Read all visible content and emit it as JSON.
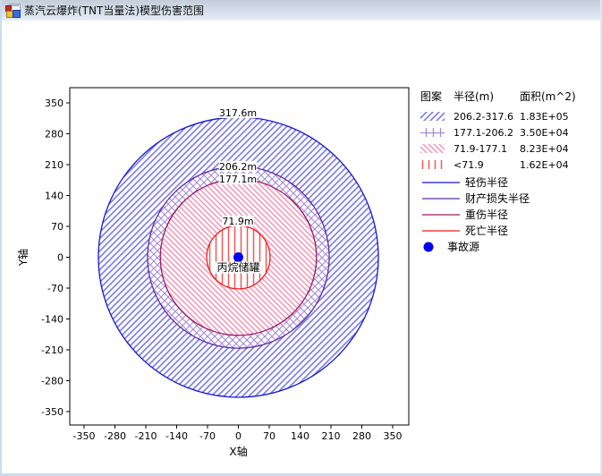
{
  "window": {
    "title": "蒸汽云爆炸(TNT当量法)模型伤害范围"
  },
  "chart_data": {
    "type": "area",
    "description": "Concentric damage-radius zones for vapor cloud explosion (TNT equivalency method)",
    "xlabel": "X轴",
    "ylabel": "Y轴",
    "x_ticks": [
      -350,
      -280,
      -210,
      -140,
      -70,
      0,
      70,
      140,
      210,
      280,
      350
    ],
    "y_ticks": [
      350,
      280,
      210,
      140,
      70,
      0,
      -70,
      -140,
      -210,
      -280,
      -350
    ],
    "xlim": [
      -385,
      390
    ],
    "ylim": [
      -382,
      385
    ],
    "grid": false,
    "center_label": "丙烷储罐",
    "rings": [
      {
        "radius_m": 317.6,
        "annotation": "317.6m",
        "radius_range": "206.2-317.6",
        "area_m2": "1.83E+05",
        "line_label": "轻伤半径",
        "stroke_color": "#1616ce",
        "hatch_style": "diagonal-up",
        "hatch_color": "#8282ea"
      },
      {
        "radius_m": 206.2,
        "annotation": "206.2m",
        "radius_range": "177.1-206.2",
        "area_m2": "3.50E+04",
        "line_label": "财产损失半径",
        "stroke_color": "#5f2da0",
        "hatch_style": "crosshatch",
        "hatch_color": "#a58ad8"
      },
      {
        "radius_m": 177.1,
        "annotation": "177.1m",
        "radius_range": "71.9-177.1",
        "area_m2": "8.23E+04",
        "line_label": "重伤半径",
        "stroke_color": "#9c1a60",
        "hatch_style": "diagonal-down",
        "hatch_color": "#f29cba"
      },
      {
        "radius_m": 71.9,
        "annotation": "71.9m",
        "radius_range": "<71.9",
        "area_m2": "1.62E+04",
        "line_label": "死亡半径",
        "stroke_color": "#ee1a1a",
        "hatch_style": "vertical",
        "hatch_color": "#f05858"
      }
    ],
    "legend": {
      "headers": [
        "图案",
        "半径(m)",
        "面积(m^2)"
      ],
      "source": {
        "label": "事故源",
        "color": "#0000f2"
      }
    }
  }
}
